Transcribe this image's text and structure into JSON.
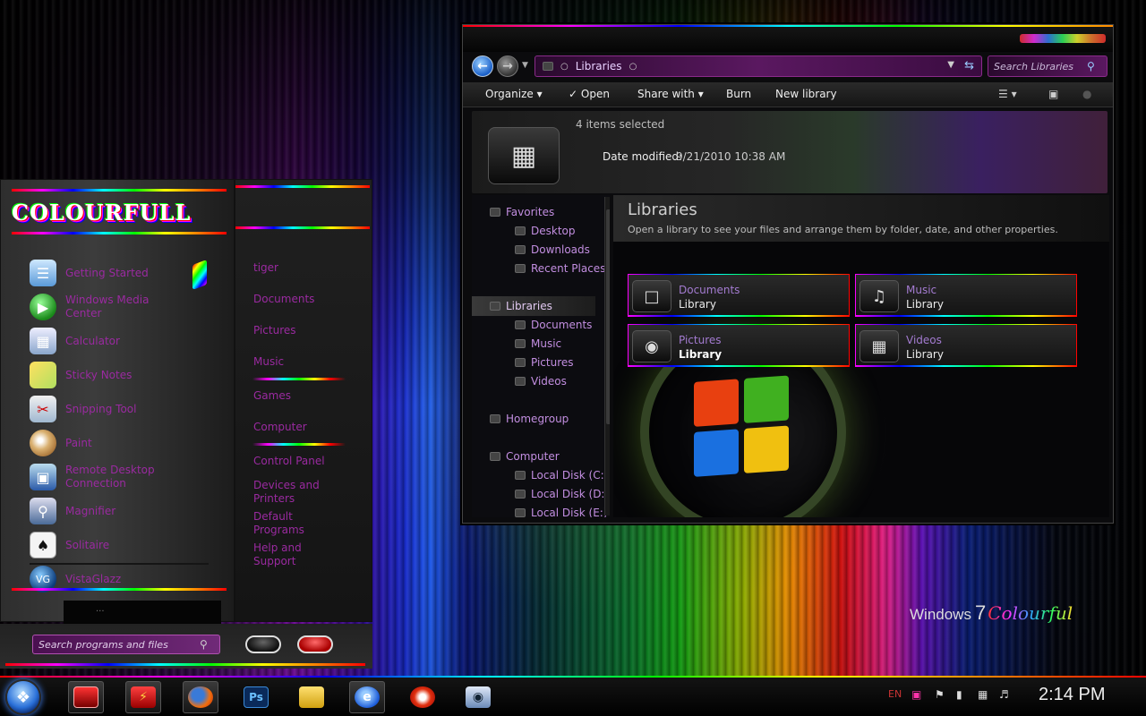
{
  "desktop": {
    "brand": {
      "prefix": "Windows",
      "version": "7",
      "flourish": "Colourful"
    }
  },
  "explorer": {
    "address": {
      "crumb": "Libraries"
    },
    "search": {
      "placeholder": "Search Libraries"
    },
    "toolbar": {
      "organize": "Organize",
      "open": "Open",
      "share_with": "Share with",
      "burn": "Burn",
      "new_library": "New library"
    },
    "details": {
      "selection": "4 items selected",
      "modified_label": "Date modified:",
      "modified_value": "9/21/2010 10:38 AM"
    },
    "nav": {
      "favorites": "Favorites",
      "desktop": "Desktop",
      "downloads": "Downloads",
      "recent": "Recent Places",
      "libraries": "Libraries",
      "documents": "Documents",
      "music": "Music",
      "pictures": "Pictures",
      "videos": "Videos",
      "homegroup": "Homegroup",
      "computer": "Computer",
      "disk_c": "Local Disk (C:)",
      "disk_d": "Local Disk (D:)",
      "disk_e": "Local Disk (E:)"
    },
    "content": {
      "title": "Libraries",
      "subtitle": "Open a library to see your files and arrange them by folder, date, and other properties.",
      "tiles": [
        {
          "name": "Documents",
          "type": "Library",
          "icon": "document-icon"
        },
        {
          "name": "Music",
          "type": "Library",
          "icon": "music-note-icon"
        },
        {
          "name": "Pictures",
          "type": "Library",
          "icon": "camera-icon"
        },
        {
          "name": "Videos",
          "type": "Library",
          "icon": "film-icon"
        }
      ]
    }
  },
  "start_menu": {
    "logo": "COLOURFULL",
    "programs": [
      {
        "label": "Getting Started",
        "icon": "getting-started-icon"
      },
      {
        "label": "Windows Media Center",
        "icon": "media-center-icon"
      },
      {
        "label": "Calculator",
        "icon": "calculator-icon"
      },
      {
        "label": "Sticky Notes",
        "icon": "sticky-notes-icon"
      },
      {
        "label": "Snipping Tool",
        "icon": "scissors-icon"
      },
      {
        "label": "Paint",
        "icon": "palette-icon"
      },
      {
        "label": "Remote Desktop Connection",
        "icon": "remote-desktop-icon"
      },
      {
        "label": "Magnifier",
        "icon": "magnifier-icon"
      },
      {
        "label": "Solitaire",
        "icon": "playing-card-icon"
      },
      {
        "label": "VistaGlazz",
        "icon": "vistaglazz-icon"
      }
    ],
    "bottom_strip": "...",
    "places": {
      "user": "tiger",
      "documents": "Documents",
      "pictures": "Pictures",
      "music": "Music",
      "games": "Games",
      "computer": "Computer",
      "control_panel": "Control Panel",
      "devices": "Devices and Printers",
      "defaults": "Default Programs",
      "help": "Help and Support"
    },
    "search": {
      "placeholder": "Search programs and files"
    }
  },
  "taskbar": {
    "apps": [
      {
        "name": "terminal",
        "label": ""
      },
      {
        "name": "winamp",
        "label": ""
      },
      {
        "name": "firefox",
        "label": ""
      },
      {
        "name": "photoshop",
        "label": "Ps"
      },
      {
        "name": "folder",
        "label": ""
      },
      {
        "name": "ie",
        "label": ""
      },
      {
        "name": "ccleaner",
        "label": ""
      },
      {
        "name": "screenshot",
        "label": ""
      }
    ],
    "tray": {
      "lang": "EN"
    },
    "clock": "2:14 PM"
  },
  "colors": {
    "purple_text": "#9a2aa0",
    "nav_text": "#c28ee0",
    "tile_name": "#a37bd0",
    "accent_blue": "#2a70d8"
  }
}
